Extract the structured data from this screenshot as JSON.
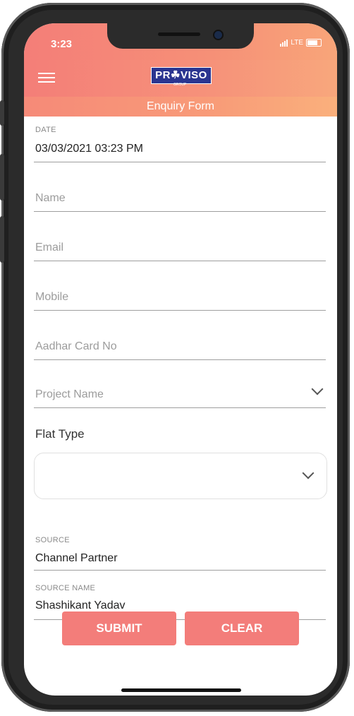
{
  "status": {
    "time": "3:23",
    "network": "LTE"
  },
  "app": {
    "logo_text": "PR☘VISO",
    "logo_sub": "GROUP",
    "screen_title": "Enquiry Form"
  },
  "form": {
    "date": {
      "label": "DATE",
      "value": "03/03/2021 03:23 PM"
    },
    "name": {
      "placeholder": "Name"
    },
    "email": {
      "placeholder": "Email"
    },
    "mobile": {
      "placeholder": "Mobile"
    },
    "aadhar": {
      "placeholder": "Aadhar Card No"
    },
    "project": {
      "placeholder": "Project Name"
    },
    "flat_type": {
      "label": "Flat Type",
      "value": ""
    },
    "source": {
      "label": "SOURCE",
      "value": "Channel Partner"
    },
    "source_name": {
      "label": "SOURCE NAME",
      "value": "Shashikant Yadav"
    }
  },
  "actions": {
    "submit": "SUBMIT",
    "clear": "CLEAR"
  },
  "colors": {
    "accent": "#f37d7a",
    "header_start": "#f47e78",
    "header_end": "#f8a579",
    "logo_bg": "#2a3590"
  }
}
